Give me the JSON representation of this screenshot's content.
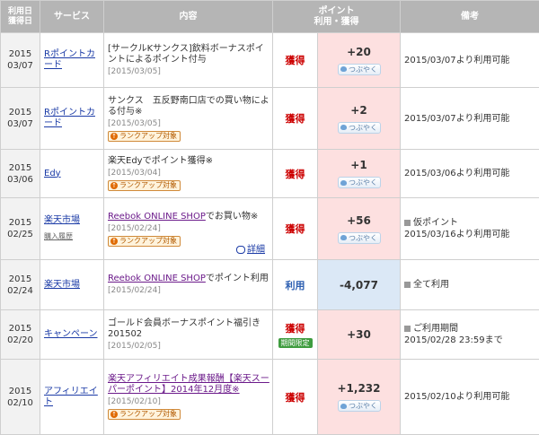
{
  "header": {
    "date": "利用日\n獲得日",
    "service": "サービス",
    "content": "内容",
    "points": "ポイント\n利用・獲得",
    "note": "備考"
  },
  "tweet_label": "つぶやく",
  "rank_label": "ランクアップ対象",
  "detail_label": "詳細",
  "limited_label": "期間限定",
  "rows": [
    {
      "year": "2015",
      "md": "03/07",
      "service": "Rポイントカード",
      "content": "[サークルKサンクス]飲料ボーナスポイントによるポイント付与",
      "content_date": "[2015/03/05]",
      "type": "獲得",
      "points": "+20",
      "note": "2015/03/07より利用可能"
    },
    {
      "year": "2015",
      "md": "03/07",
      "service": "Rポイントカード",
      "content": "サンクス　五反野南口店での買い物による付与※",
      "content_date": "[2015/03/05]",
      "type": "獲得",
      "points": "+2",
      "note": "2015/03/07より利用可能"
    },
    {
      "year": "2015",
      "md": "03/06",
      "service": "Edy",
      "content": "楽天Edyでポイント獲得※",
      "content_date": "[2015/03/04]",
      "type": "獲得",
      "points": "+1",
      "note": "2015/03/06より利用可能"
    },
    {
      "year": "2015",
      "md": "02/25",
      "service": "楽天市場",
      "service_sub": "購入履歴",
      "content_link": "Reebok ONLINE SHOP",
      "content_rest": "でお買い物※",
      "content_date": "[2015/02/24]",
      "type": "獲得",
      "points": "+56",
      "note1": "仮ポイント",
      "note2": "2015/03/16より利用可能"
    },
    {
      "year": "2015",
      "md": "02/24",
      "service": "楽天市場",
      "content_link": "Reebok ONLINE SHOP",
      "content_rest": "でポイント利用",
      "content_date": "[2015/02/24]",
      "type": "利用",
      "points": "-4,077",
      "note1": "全て利用"
    },
    {
      "year": "2015",
      "md": "02/20",
      "service": "キャンペーン",
      "content": "ゴールド会員ボーナスポイント福引き201502",
      "content_date": "[2015/02/05]",
      "type": "獲得",
      "points": "+30",
      "note1": "ご利用期間",
      "note2": "2015/02/28 23:59まで"
    },
    {
      "year": "2015",
      "md": "02/10",
      "service": "アフィリエイト",
      "content": "楽天アフィリエイト成果報酬【楽天スーパーポイント】2014年12月度※",
      "content_date": "[2015/02/10]",
      "type": "獲得",
      "points": "+1,232",
      "note": "2015/02/10より利用可能"
    }
  ]
}
